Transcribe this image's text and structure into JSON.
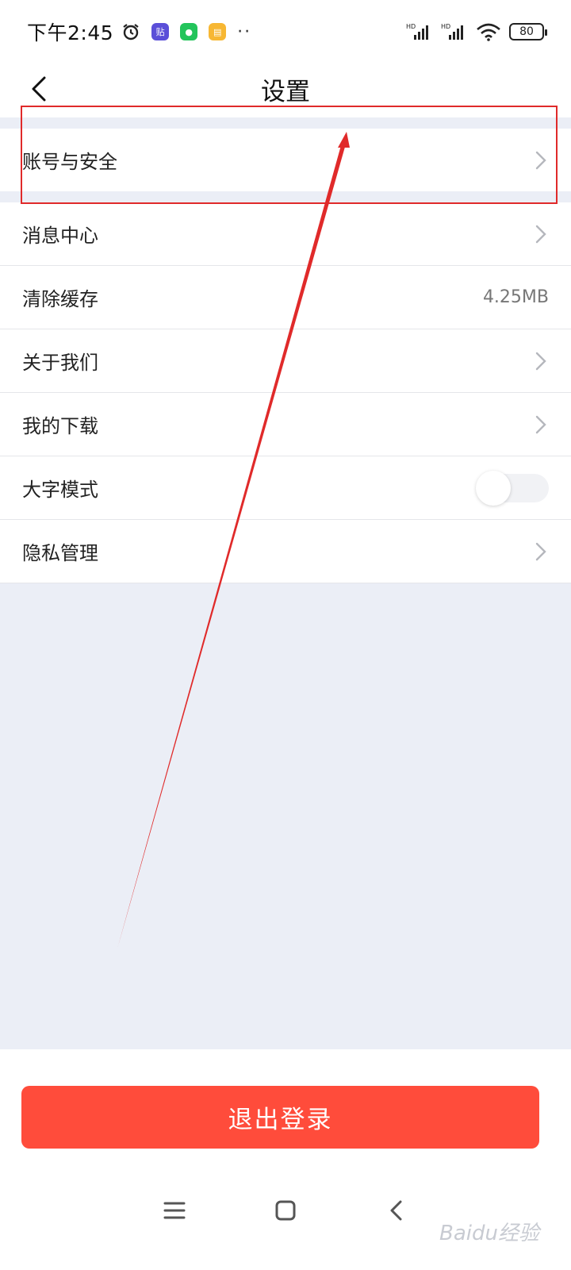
{
  "status_bar": {
    "time": "下午2:45",
    "battery": "80",
    "icons": [
      "alarm-icon",
      "tieba-app-icon",
      "wechat-app-icon",
      "notes-app-icon",
      "more-dots-icon",
      "signal-hd-icon",
      "signal-hd-icon",
      "wifi-icon",
      "battery-icon"
    ]
  },
  "header": {
    "title": "设置",
    "back_icon": "back-chevron-icon"
  },
  "settings": {
    "items": [
      {
        "label": "账号与安全",
        "control": "chevron"
      },
      {
        "label": "消息中心",
        "control": "chevron"
      },
      {
        "label": "清除缓存",
        "control": "value",
        "value": "4.25MB"
      },
      {
        "label": "关于我们",
        "control": "chevron"
      },
      {
        "label": "我的下载",
        "control": "chevron"
      },
      {
        "label": "大字模式",
        "control": "toggle",
        "enabled": false
      },
      {
        "label": "隐私管理",
        "control": "chevron"
      }
    ]
  },
  "logout": {
    "label": "退出登录"
  },
  "system_nav": {
    "icons": [
      "menu-icon",
      "home-icon",
      "back-icon"
    ]
  },
  "watermark": "Baidu经验",
  "colors": {
    "accent": "#ff4c3b",
    "background_grey": "#ebeef6",
    "annotation": "#e02a2a"
  }
}
